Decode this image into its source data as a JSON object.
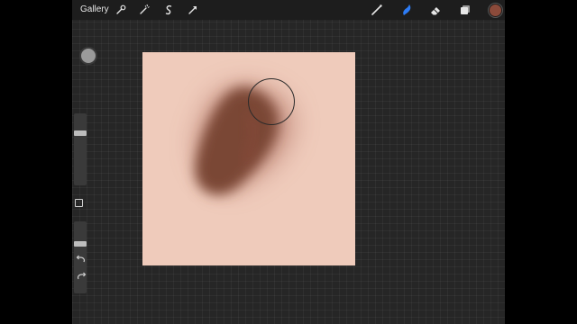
{
  "topbar": {
    "gallery_label": "Gallery",
    "left_tools": [
      "wrench-icon",
      "magic-wand-icon",
      "selection-icon",
      "transform-arrow-icon"
    ],
    "right_tools": [
      "brush-icon",
      "smudge-icon",
      "eraser-icon",
      "layers-icon"
    ]
  },
  "colors": {
    "ui_background": "#262626",
    "toolbar": "#1d1d1d",
    "active_tool": "#2d7cf6",
    "canvas": "#efcbbb",
    "stroke": "#7a4636",
    "current_color": "#8b4a3a"
  },
  "sidebar": {
    "size_slider_level": 0.25,
    "opacity_slider_level": 0.3,
    "undo_icon": "undo-icon",
    "redo_icon": "redo-icon"
  }
}
